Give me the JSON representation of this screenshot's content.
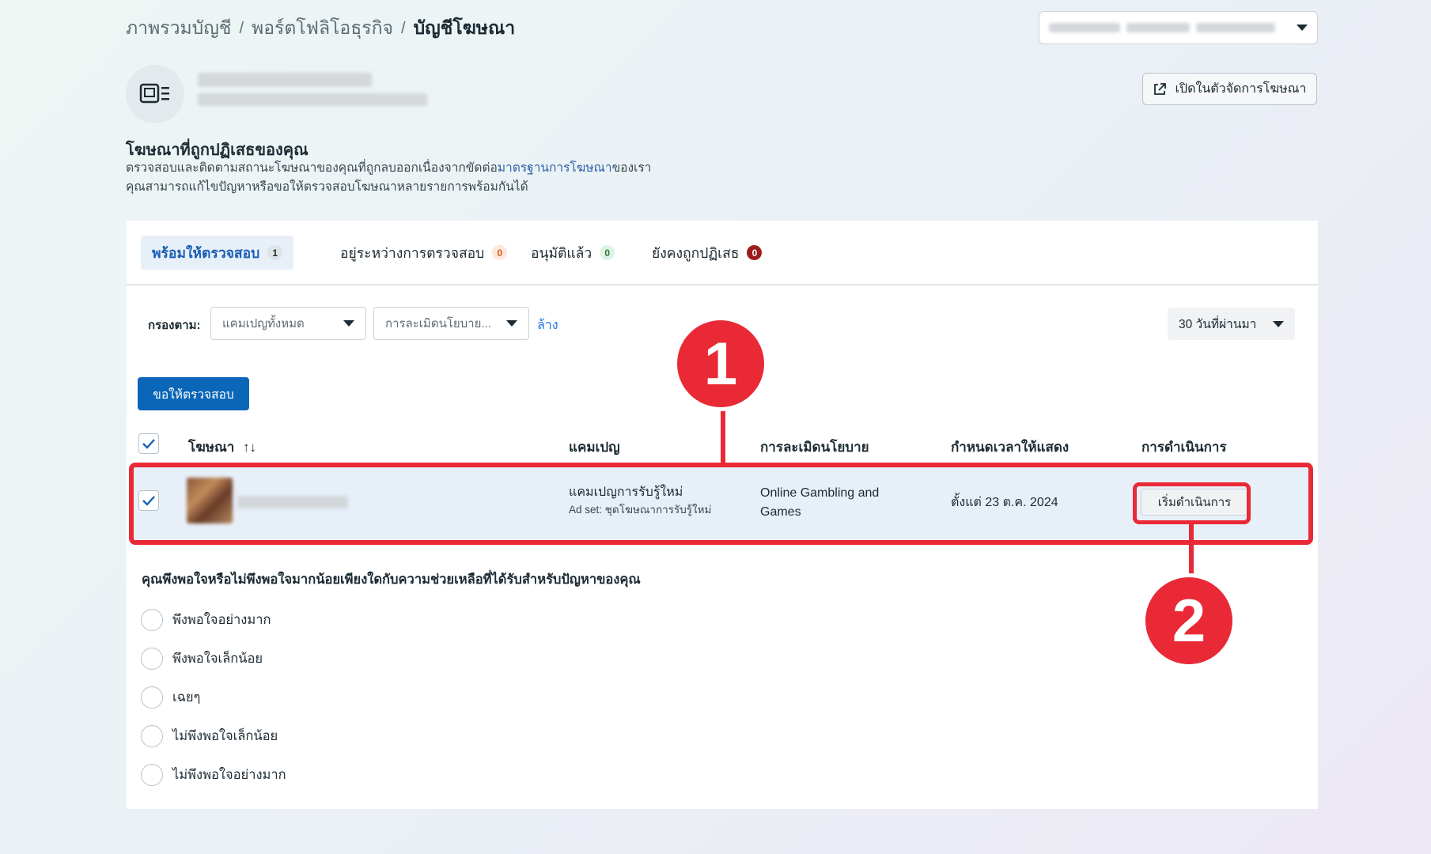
{
  "breadcrumb": {
    "items": [
      "ภาพรวมบัญชี",
      "พอร์ตโฟลิโอธุรกิจ",
      "บัญชีโฆษณา"
    ],
    "separator": "/"
  },
  "header": {
    "open_manager_label": "เปิดในตัวจัดการโฆษณา",
    "open_manager_icon": "external-link-icon",
    "account_icon": "ad-account-icon"
  },
  "section": {
    "title": "โฆษณาที่ถูกปฏิเสธของคุณ",
    "desc_part1": "ตรวจสอบและติดตามสถานะโฆษณาของคุณที่ถูกลบออกเนื่องจากขัดต่อ",
    "desc_link": "มาตรฐานการโฆษณา",
    "desc_part2": "ของเรา",
    "desc_line2": "คุณสามารถแก้ไขปัญหาหรือขอให้ตรวจสอบโฆษณาหลายรายการพร้อมกันได้"
  },
  "tabs": [
    {
      "label": "พร้อมให้ตรวจสอบ",
      "count": "1"
    },
    {
      "label": "อยู่ระหว่างการตรวจสอบ",
      "count": "0"
    },
    {
      "label": "อนุมัติแล้ว",
      "count": "0"
    },
    {
      "label": "ยังคงถูกปฏิเสธ",
      "count": "0"
    }
  ],
  "filters": {
    "label": "กรองตาม:",
    "campaign_dropdown": "แคมเปญทั้งหมด",
    "policy_dropdown": "การละเมิดนโยบาย...",
    "clear_label": "ล้าง",
    "date_range": "30 วันที่ผ่านมา"
  },
  "request_review_label": "ขอให้ตรวจสอบ",
  "table": {
    "headers": {
      "ad": "โฆษณา",
      "sort_icon": "↑↓",
      "campaign": "แคมเปญ",
      "policy": "การละเมิดนโยบาย",
      "schedule": "กำหนดเวลาให้แสดง",
      "action": "การดำเนินการ"
    },
    "rows": [
      {
        "selected": true,
        "campaign": "แคมเปญการรับรู้ใหม่",
        "ad_set": "Ad set: ชุดโฆษณาการรับรู้ใหม่",
        "policy_line1": "Online Gambling and",
        "policy_line2": "Games",
        "schedule": "ตั้งแต่ 23 ต.ค. 2024",
        "action_label": "เริ่มดำเนินการ"
      }
    ]
  },
  "survey": {
    "question": "คุณพึงพอใจหรือไม่พึงพอใจมากน้อยเพียงใดกับความช่วยเหลือที่ได้รับสำหรับปัญหาของคุณ",
    "options": [
      "พึงพอใจอย่างมาก",
      "พึงพอใจเล็กน้อย",
      "เฉยๆ",
      "ไม่พึงพอใจเล็กน้อย",
      "ไม่พึงพอใจอย่างมาก"
    ]
  },
  "annotations": {
    "marker_1": "1",
    "marker_2": "2",
    "color": "#e92a36"
  },
  "colors": {
    "primary": "#0a66b8",
    "active_tab_text": "#1a5fb4",
    "row_highlight": "#e7eff9"
  }
}
